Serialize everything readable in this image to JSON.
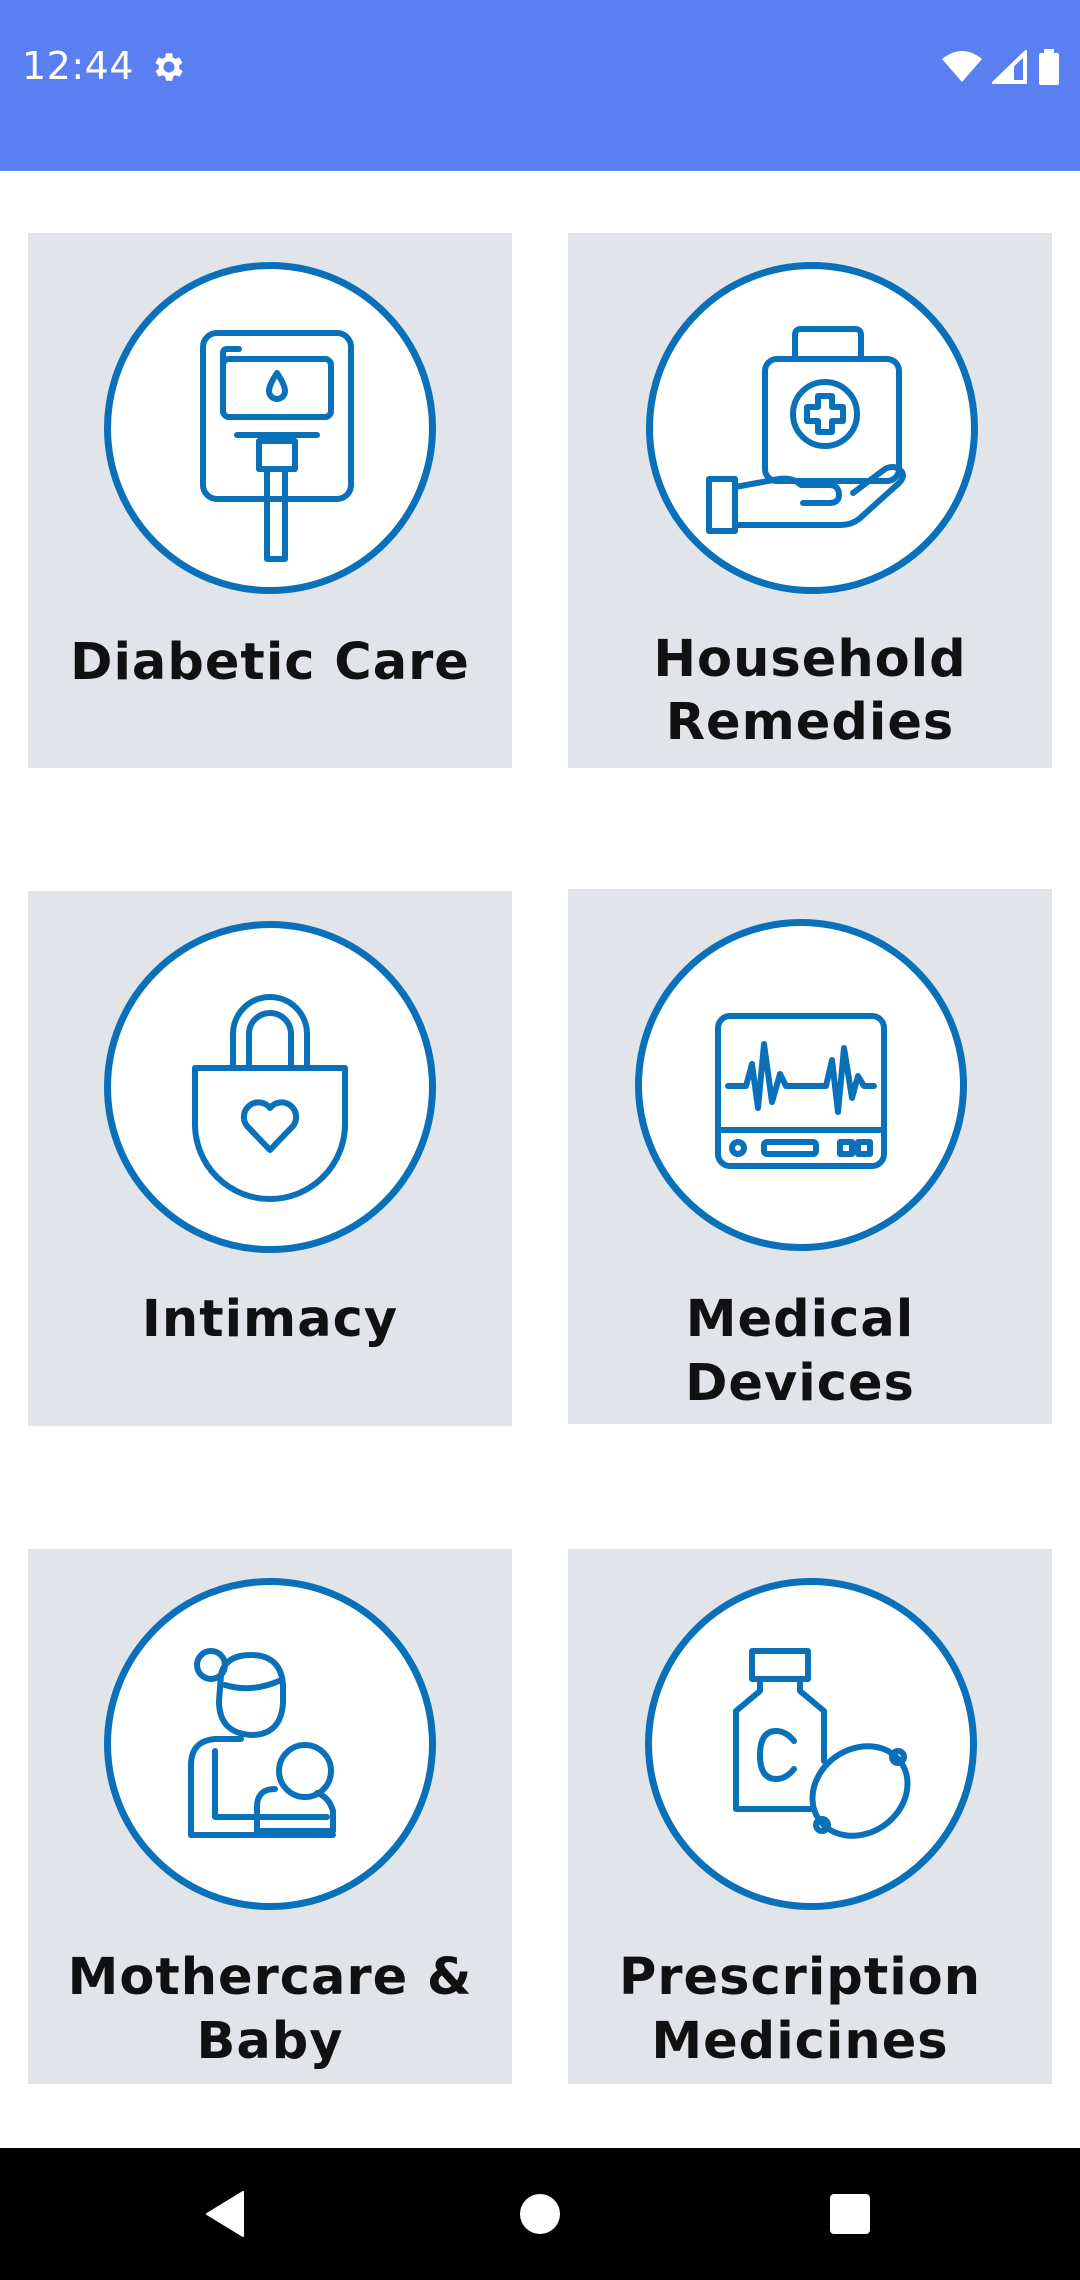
{
  "status_bar": {
    "time": "12:44",
    "settings_icon": "gear-icon",
    "wifi_icon": "wifi-icon",
    "signal_icon": "signal-icon",
    "battery_icon": "battery-icon",
    "background_color": "#5a7ff0"
  },
  "categories": [
    {
      "label_line1": "Diabetic Care",
      "label_line2": "",
      "icon": "glucometer-icon"
    },
    {
      "label_line1": "Household",
      "label_line2": "Remedies",
      "icon": "first-aid-kit-icon"
    },
    {
      "label_line1": "Intimacy",
      "label_line2": "",
      "icon": "heart-lock-icon"
    },
    {
      "label_line1": "Medical",
      "label_line2": "Devices",
      "icon": "heart-monitor-icon"
    },
    {
      "label_line1": "Mothercare &",
      "label_line2": "Baby",
      "icon": "mother-baby-icon"
    },
    {
      "label_line1": "Prescription",
      "label_line2": "Medicines",
      "icon": "vitamin-c-icon"
    }
  ],
  "theme": {
    "icon_blue": "#0a70b9",
    "tile_gray": "#e1e4e8"
  },
  "nav_bar": {
    "back_icon": "back-icon",
    "home_icon": "home-icon",
    "recents_icon": "recents-icon"
  }
}
